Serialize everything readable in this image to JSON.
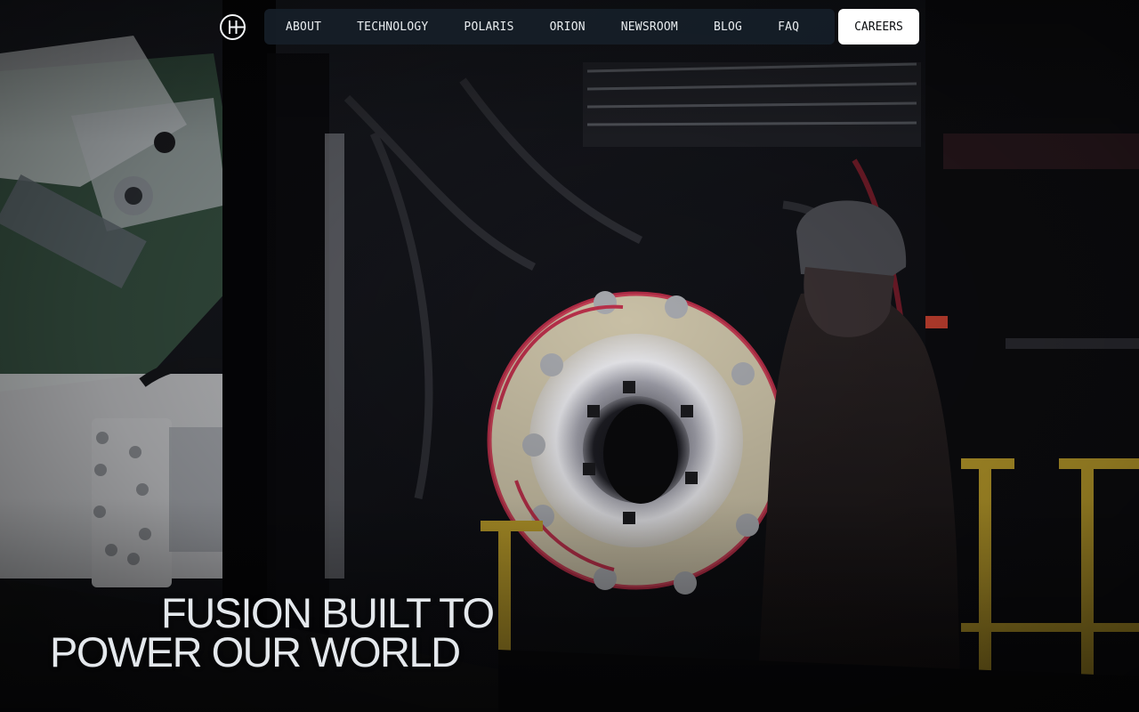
{
  "header": {
    "logo_name": "fusion-logo-icon",
    "nav": {
      "items": [
        {
          "label": "ABOUT"
        },
        {
          "label": "TECHNOLOGY"
        },
        {
          "label": "POLARIS"
        },
        {
          "label": "ORION"
        },
        {
          "label": "NEWSROOM"
        },
        {
          "label": "BLOG"
        },
        {
          "label": "FAQ"
        }
      ]
    },
    "cta_label": "CAREERS"
  },
  "hero": {
    "headline_line_1": "FUSION BUILT TO",
    "headline_line_2": "POWER OUR WORLD",
    "image_subject": "fusion machine with technician in helmet"
  },
  "colors": {
    "nav_background": "#161e28",
    "nav_text": "#e8ecef",
    "cta_background": "#ffffff",
    "cta_text": "#0b0d10",
    "headline_text": "#e4e8ec",
    "accent_red": "#c0304a",
    "accent_yellow": "#b89a2a"
  }
}
